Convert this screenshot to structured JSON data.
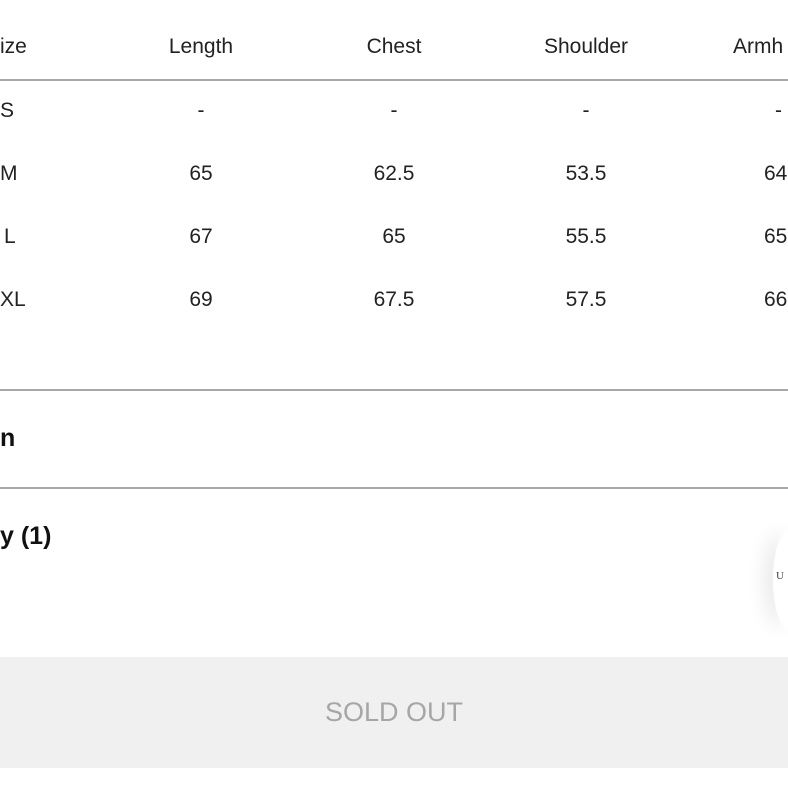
{
  "size_table": {
    "headers": [
      "ize",
      "Length",
      "Chest",
      "Shoulder",
      "Armh"
    ],
    "rows": [
      [
        "S",
        "-",
        "-",
        "-",
        "-"
      ],
      [
        "M",
        "65",
        "62.5",
        "53.5",
        "64"
      ],
      [
        "L",
        "67",
        "65",
        "55.5",
        "65"
      ],
      [
        "XL",
        "69",
        "67.5",
        "57.5",
        "66"
      ]
    ]
  },
  "sections": {
    "first_label": "n",
    "second_label": "y (1)"
  },
  "floating_button": {
    "text": "U"
  },
  "buy_button": {
    "label": "SOLD OUT"
  },
  "colors": {
    "divider": "#a8a8a8",
    "button_bg": "#f0f0f0",
    "button_text": "#a6a6a6"
  }
}
